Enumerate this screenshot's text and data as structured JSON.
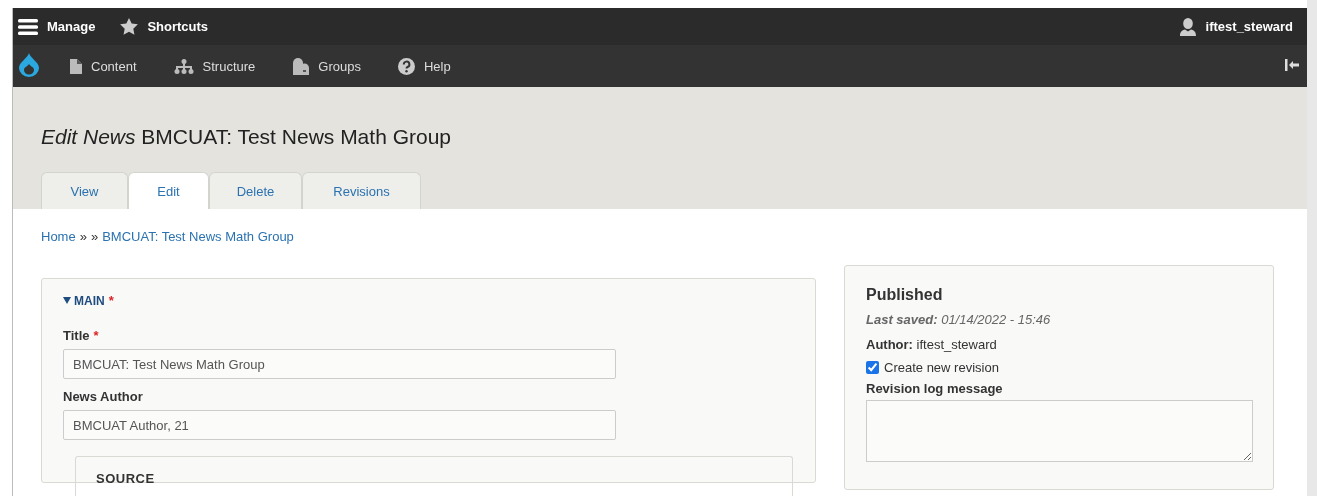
{
  "toolbar": {
    "tray": [
      {
        "kind": "menu",
        "label": "Manage"
      },
      {
        "kind": "star",
        "label": "Shortcuts"
      }
    ],
    "user": {
      "label": "iftest_steward"
    },
    "menu": [
      {
        "kind": "page",
        "label": "Content"
      },
      {
        "kind": "structure",
        "label": "Structure"
      },
      {
        "kind": "groups",
        "label": "Groups"
      },
      {
        "kind": "help",
        "label": "Help"
      }
    ]
  },
  "page_title": "*Edit News* BMCUAT: Test News Math Group",
  "tabs": [
    {
      "label": "View",
      "selected": false
    },
    {
      "label": "Edit",
      "selected": true
    },
    {
      "label": "Delete",
      "selected": false
    },
    {
      "label": "Revisions",
      "selected": false
    }
  ],
  "breadcrumb": [
    {
      "kind": "link",
      "text": "Home"
    },
    {
      "kind": "separator",
      "text": "»"
    },
    {
      "kind": "separator",
      "text": "»"
    },
    {
      "kind": "link",
      "text": "BMCUAT: Test News Math Group"
    }
  ],
  "main": {
    "legend": "MAIN",
    "expanded": true,
    "required_mark": "*",
    "fields": [
      {
        "label": "Title",
        "required_mark": "*",
        "value": "BMCUAT: Test News Math Group"
      },
      {
        "label": "News Author",
        "value": "BMCUAT Author, 21"
      }
    ],
    "source": {
      "legend": "SOURCE"
    }
  },
  "meta": {
    "status": "Published",
    "last_saved": "**Last saved:** 01/14/2022 - 15:46",
    "author": "**Author:** iftest_steward",
    "new_revision": {
      "label": "Create new revision",
      "checked": true
    },
    "log": {
      "label": "Revision log message"
    }
  }
}
